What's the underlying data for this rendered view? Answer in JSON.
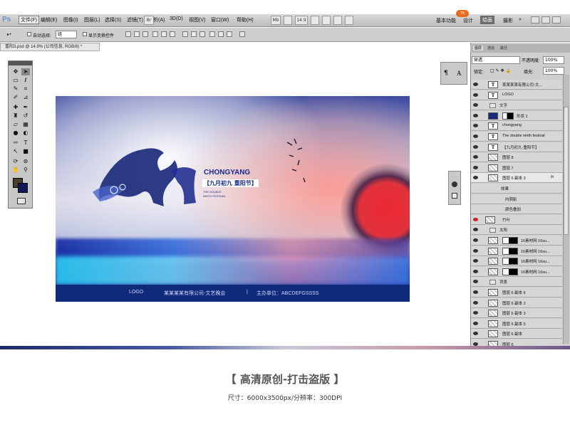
{
  "app": {
    "logo": "Ps",
    "badge": "76"
  },
  "menu": [
    "文件(F)",
    "编辑(E)",
    "图像(I)",
    "图层(L)",
    "选择(S)",
    "滤镜(T)",
    "分析(A)",
    "3D(D)",
    "视图(V)",
    "窗口(W)",
    "帮助(H)"
  ],
  "menubar_extras": {
    "br": "Br",
    "mb": "Mb",
    "zoom": "14.9"
  },
  "workspaces": {
    "basic": "基本功能",
    "design": "设计",
    "painting": "绘画",
    "photography": "摄影",
    "more": "»"
  },
  "options": {
    "auto_select_label": "自动选择:",
    "auto_select_value": "组",
    "show_transform": "显示变换控件"
  },
  "document": {
    "tab_title": "重阳3.psd @ 14.9% (公司信息, RGB/8) *"
  },
  "artwork": {
    "title_en": "CHONGYANG",
    "title_cn": "【九月初九  重阳节】",
    "small1": "THE DOUBLE",
    "small2": "NINTH FESTIVAL",
    "footer_logo": "LOGO",
    "footer_company": "某某某某有限公司-文艺晚会",
    "footer_sep": "|",
    "footer_host": "主办单位：ABCDEFGSSSS"
  },
  "dock_icons": {
    "para": "¶",
    "char": "A"
  },
  "layers_panel": {
    "tabs": [
      "图层",
      "通道",
      "路径"
    ],
    "blend_mode": "穿透",
    "opacity_label": "不透明度:",
    "opacity_value": "100%",
    "lock_label": "锁定:",
    "fill_label": "填充:",
    "fill_value": "100%",
    "rows": [
      {
        "type": "text",
        "indent": 1,
        "name": "某某某某有限公司-文..."
      },
      {
        "type": "text",
        "indent": 1,
        "name": "LOGO"
      },
      {
        "type": "group",
        "indent": 0,
        "name": "文字"
      },
      {
        "type": "shape",
        "indent": 1,
        "name": "形状 1"
      },
      {
        "type": "text",
        "indent": 1,
        "name": "chongyang"
      },
      {
        "type": "text",
        "indent": 1,
        "name": "The double  ninth festival"
      },
      {
        "type": "text",
        "indent": 1,
        "name": "【九月初九-重阳节】"
      },
      {
        "type": "pixel",
        "indent": 1,
        "name": "图层 8"
      },
      {
        "type": "pixel",
        "indent": 1,
        "name": "图层 7"
      },
      {
        "type": "pixel",
        "indent": 1,
        "name": "图层 6 副本 3",
        "fx": "fx"
      },
      {
        "type": "effect",
        "indent": 2,
        "name": "效果"
      },
      {
        "type": "effect",
        "indent": 3,
        "name": "内阴影"
      },
      {
        "type": "effect",
        "indent": 3,
        "name": "颜色叠加"
      },
      {
        "type": "pixel",
        "indent": 0,
        "name": "竹叶",
        "red": true
      },
      {
        "type": "group",
        "indent": 0,
        "name": "太阳"
      },
      {
        "type": "mask",
        "indent": 1,
        "name": "16素材网 16su..."
      },
      {
        "type": "mask",
        "indent": 1,
        "name": "16素材网 16su..."
      },
      {
        "type": "mask",
        "indent": 1,
        "name": "16素材网 16su..."
      },
      {
        "type": "mask",
        "indent": 1,
        "name": "16素材网 16su..."
      },
      {
        "type": "group",
        "indent": 0,
        "name": "背景"
      },
      {
        "type": "pixel",
        "indent": 1,
        "name": "图层 6 副本 6"
      },
      {
        "type": "pixel",
        "indent": 1,
        "name": "图层 6 副本 2"
      },
      {
        "type": "pixel",
        "indent": 1,
        "name": "图层 6 副本 3"
      },
      {
        "type": "pixel",
        "indent": 1,
        "name": "图层 6 副本 5"
      },
      {
        "type": "pixel",
        "indent": 1,
        "name": "图层 6 副本"
      },
      {
        "type": "pixel",
        "indent": 1,
        "name": "图层 6"
      }
    ]
  },
  "caption": {
    "main": "【 高清原创-打击盗版 】",
    "sub": "尺寸：6000x3500px/分辨率：300DPI"
  }
}
